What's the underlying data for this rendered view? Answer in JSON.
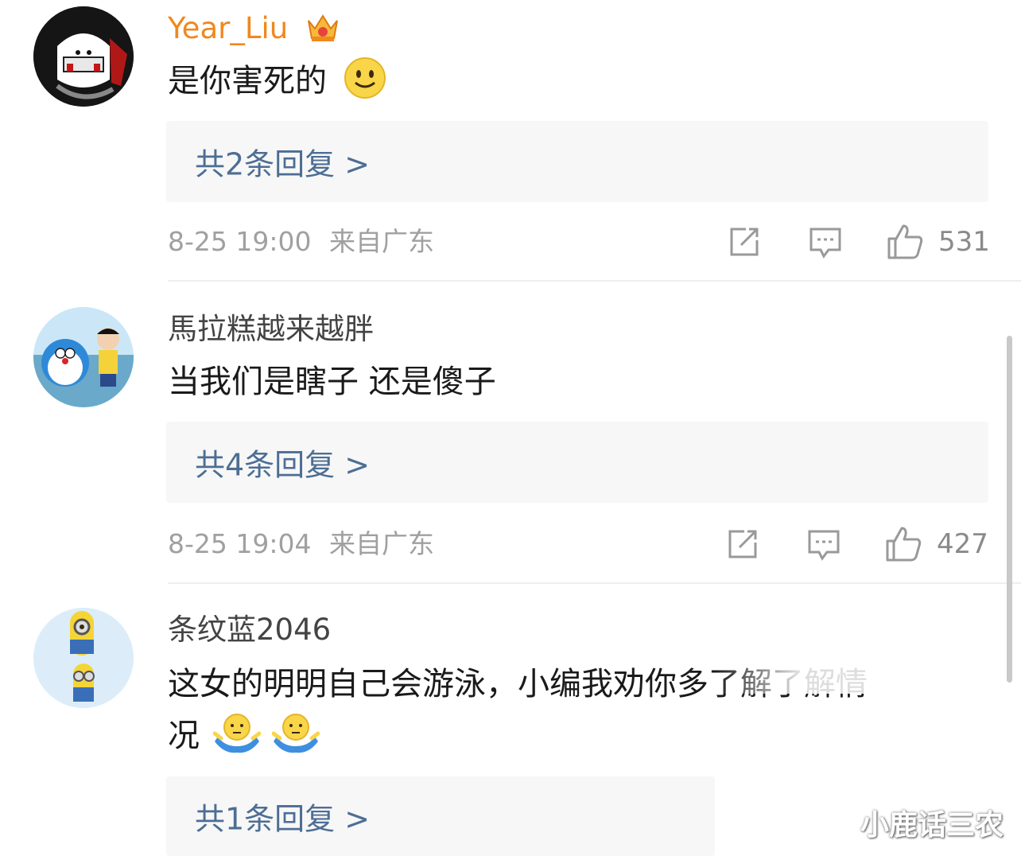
{
  "comments": [
    {
      "username": "Year_Liu",
      "username_color": "#f0881e",
      "badge_icon": "crown-icon",
      "text": "是你害死的",
      "reply_label": "共2条回复 >",
      "date": "8-25 19:00",
      "location": "来自广东",
      "likes": "531"
    },
    {
      "username": "馬拉糕越来越胖",
      "username_color": "#444444",
      "text": "当我们是瞎子 还是傻子",
      "reply_label": "共4条回复 >",
      "date": "8-25 19:04",
      "location": "来自广东",
      "likes": "427"
    },
    {
      "username": "条纹蓝2046",
      "username_color": "#444444",
      "text": "这女的明明自己会游泳，小编我劝你多了解了解情",
      "text_cont": "况",
      "reply_label": "共1条回复 >"
    }
  ],
  "watermark": "小鹿话三农",
  "colors": {
    "link": "#4d6e94",
    "meta": "#a0a0a0",
    "reply_bg": "#f7f7f7"
  }
}
